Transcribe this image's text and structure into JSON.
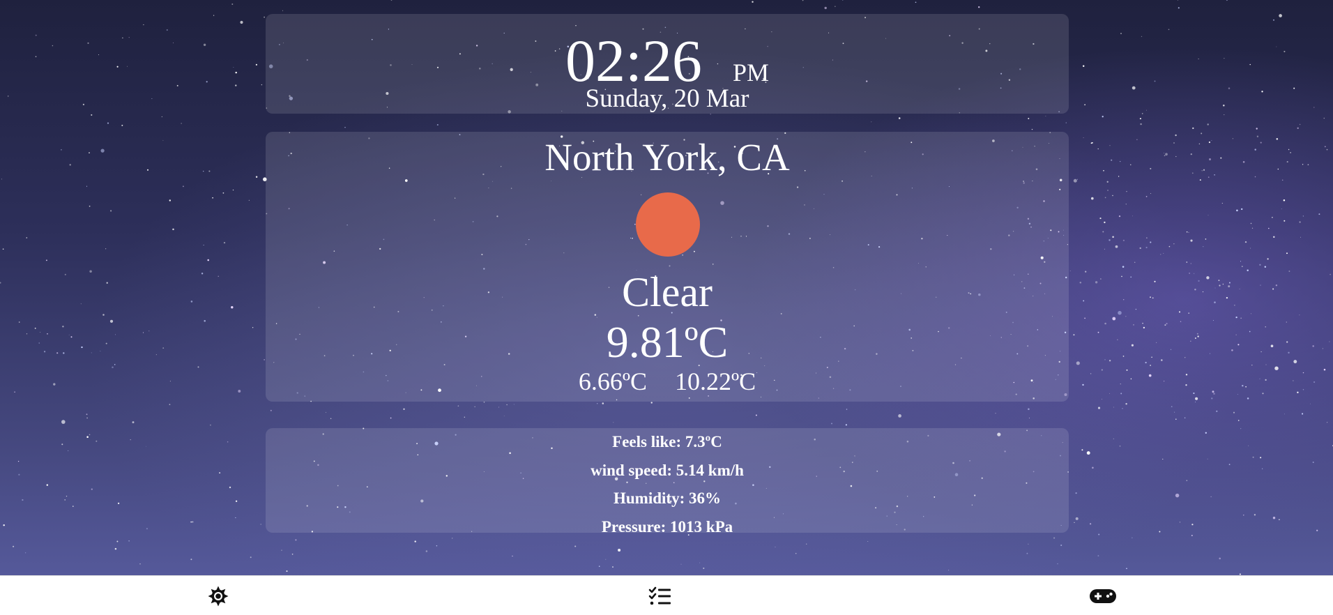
{
  "clock": {
    "time": "02:26",
    "period": "PM",
    "date": "Sunday, 20 Mar"
  },
  "weather": {
    "location": "North York, CA",
    "icon": "sun-icon",
    "condition": "Clear",
    "temperature": "9.81ºC",
    "min_temp": "6.66ºC",
    "max_temp": "10.22ºC"
  },
  "details": {
    "feels_like": "Feels like: 7.3ºC",
    "wind_speed": "wind speed: 5.14 km/h",
    "humidity": "Humidity: 36%",
    "pressure": "Pressure: 1013 kPa"
  },
  "navbar": {
    "items": [
      {
        "icon": "gear-icon"
      },
      {
        "icon": "checklist-icon"
      },
      {
        "icon": "gamepad-icon"
      }
    ]
  },
  "colors": {
    "sun": "#e86a4a",
    "card_bg": "rgba(255,255,255,0.12)",
    "navbar_bg": "#ffffff"
  }
}
